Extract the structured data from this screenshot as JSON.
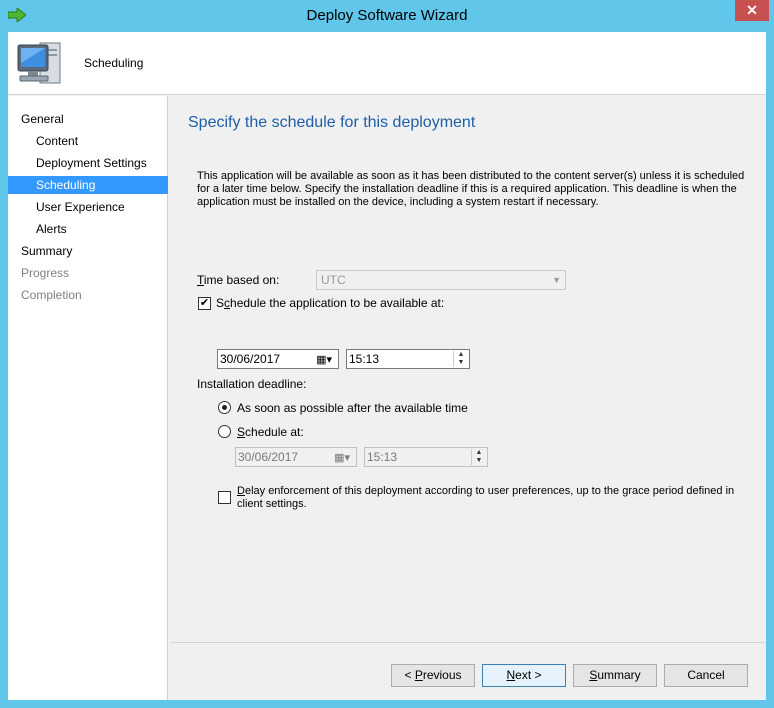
{
  "window": {
    "title": "Deploy Software Wizard",
    "close_glyph": "✕",
    "app_icon": "green-arrow-icon"
  },
  "header": {
    "title": "Scheduling",
    "icon": "computer-icon"
  },
  "nav": {
    "items": [
      {
        "label": "General",
        "state": "normal"
      },
      {
        "label": "Content",
        "state": "normal"
      },
      {
        "label": "Deployment Settings",
        "state": "normal"
      },
      {
        "label": "Scheduling",
        "state": "selected"
      },
      {
        "label": "User Experience",
        "state": "normal"
      },
      {
        "label": "Alerts",
        "state": "normal"
      },
      {
        "label": "Summary",
        "state": "normal"
      },
      {
        "label": "Progress",
        "state": "disabled"
      },
      {
        "label": "Completion",
        "state": "disabled"
      }
    ]
  },
  "main": {
    "heading": "Specify the schedule for this deployment",
    "description": "This application will be available as soon as it has been distributed to the content server(s) unless it is scheduled for a later time below. Specify the installation deadline if this is a required application. This deadline is when the application must be installed on the device, including a system restart if necessary.",
    "time_based_on_label": "Time based on:",
    "time_based_on_value": "UTC",
    "schedule_available_label": "Schedule the application to be available at:",
    "schedule_available_checked": true,
    "available_date": "30/06/2017",
    "available_time": "15:13",
    "installation_deadline_label": "Installation deadline:",
    "asap_label": "As soon as possible after the available time",
    "asap_selected": true,
    "schedule_at_label": "Schedule at:",
    "schedule_at_selected": false,
    "deadline_date": "30/06/2017",
    "deadline_time": "15:13",
    "delay_enforcement_label": "Delay enforcement of this deployment according to user preferences, up to the grace period defined in client settings.",
    "delay_enforcement_checked": false
  },
  "buttons": {
    "previous": "< Previous",
    "next": "Next >",
    "summary": "Summary",
    "cancel": "Cancel"
  },
  "colors": {
    "title_bar": "#60c6ea",
    "heading": "#1e5ea8",
    "selection": "#3399ff"
  }
}
